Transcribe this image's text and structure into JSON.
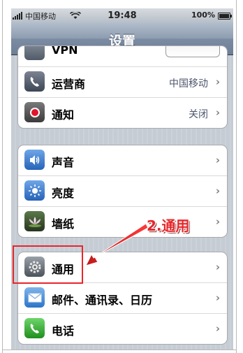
{
  "status_bar": {
    "carrier": "中国移动",
    "time": "19:48",
    "battery": "100%"
  },
  "nav_bar": {
    "title": "设置"
  },
  "groups": [
    {
      "rows": [
        {
          "label": "VPN",
          "value": "",
          "icon": "vpn-icon"
        },
        {
          "label": "运营商",
          "value": "中国移动",
          "icon": "carrier-icon"
        },
        {
          "label": "通知",
          "value": "关闭",
          "icon": "notification-icon"
        }
      ]
    },
    {
      "rows": [
        {
          "label": "声音",
          "value": "",
          "icon": "sound-icon"
        },
        {
          "label": "亮度",
          "value": "",
          "icon": "brightness-icon"
        },
        {
          "label": "墙纸",
          "value": "",
          "icon": "wallpaper-icon"
        }
      ]
    },
    {
      "rows": [
        {
          "label": "通用",
          "value": "",
          "icon": "general-gear-icon"
        },
        {
          "label": "邮件、通讯录、日历",
          "value": "",
          "icon": "mail-icon"
        },
        {
          "label": "电话",
          "value": "",
          "icon": "phone-icon"
        }
      ]
    }
  ],
  "annotation": {
    "text": "2.通用",
    "color": "#e8262a"
  }
}
